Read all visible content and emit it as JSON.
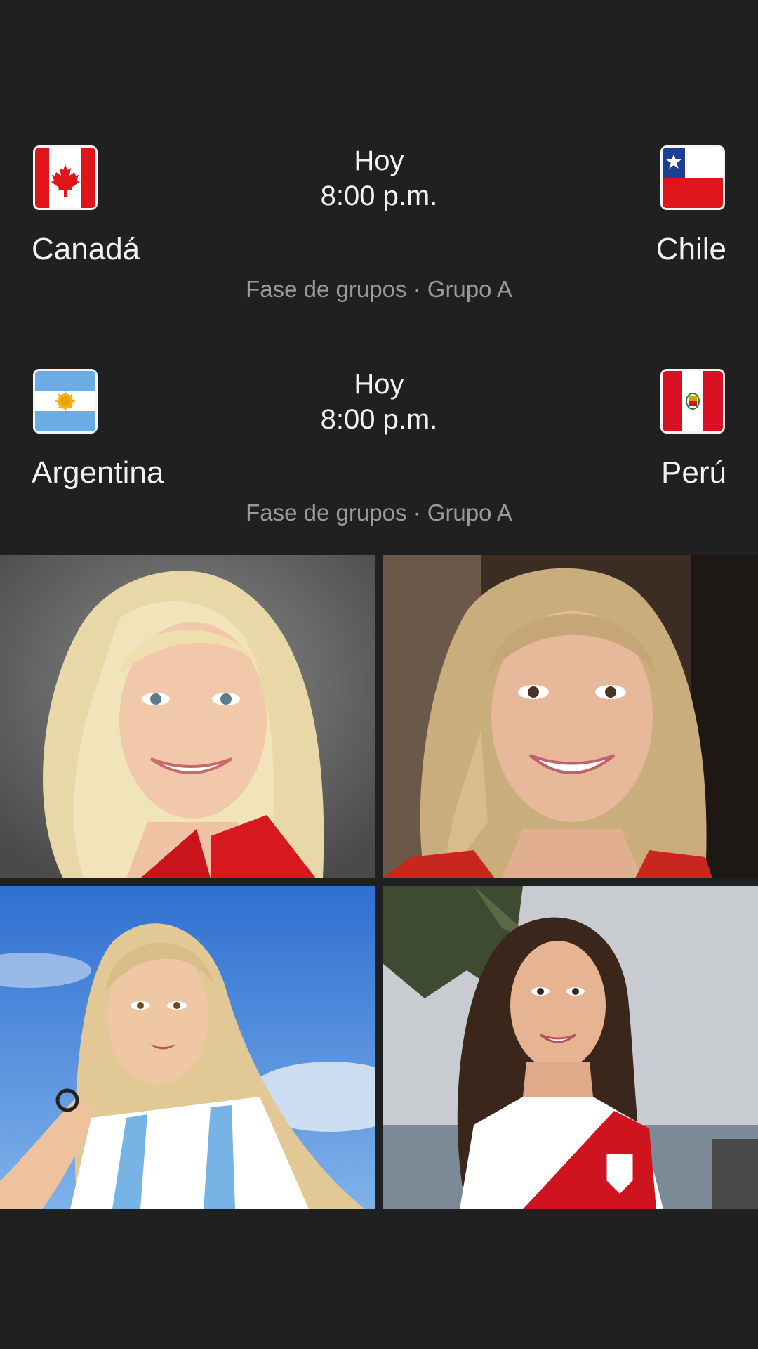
{
  "matches": [
    {
      "home": {
        "name": "Canadá",
        "flag_icon": "canada-flag-icon"
      },
      "away": {
        "name": "Chile",
        "flag_icon": "chile-flag-icon"
      },
      "day": "Hoy",
      "time": "8:00 p.m.",
      "stage": "Fase de grupos · Grupo A"
    },
    {
      "home": {
        "name": "Argentina",
        "flag_icon": "argentina-flag-icon"
      },
      "away": {
        "name": "Perú",
        "flag_icon": "peru-flag-icon"
      },
      "day": "Hoy",
      "time": "8:00 p.m.",
      "stage": "Fase de grupos · Grupo A"
    }
  ],
  "photos": [
    {
      "id": "photo-blonde-red-jacket"
    },
    {
      "id": "photo-blonde-smiling-red-top"
    },
    {
      "id": "photo-blonde-argentina-jersey"
    },
    {
      "id": "photo-brunette-peru-jersey"
    }
  ],
  "colors": {
    "background": "#202020",
    "text_primary": "#f2f2f2",
    "text_secondary": "#9a9a9a"
  }
}
